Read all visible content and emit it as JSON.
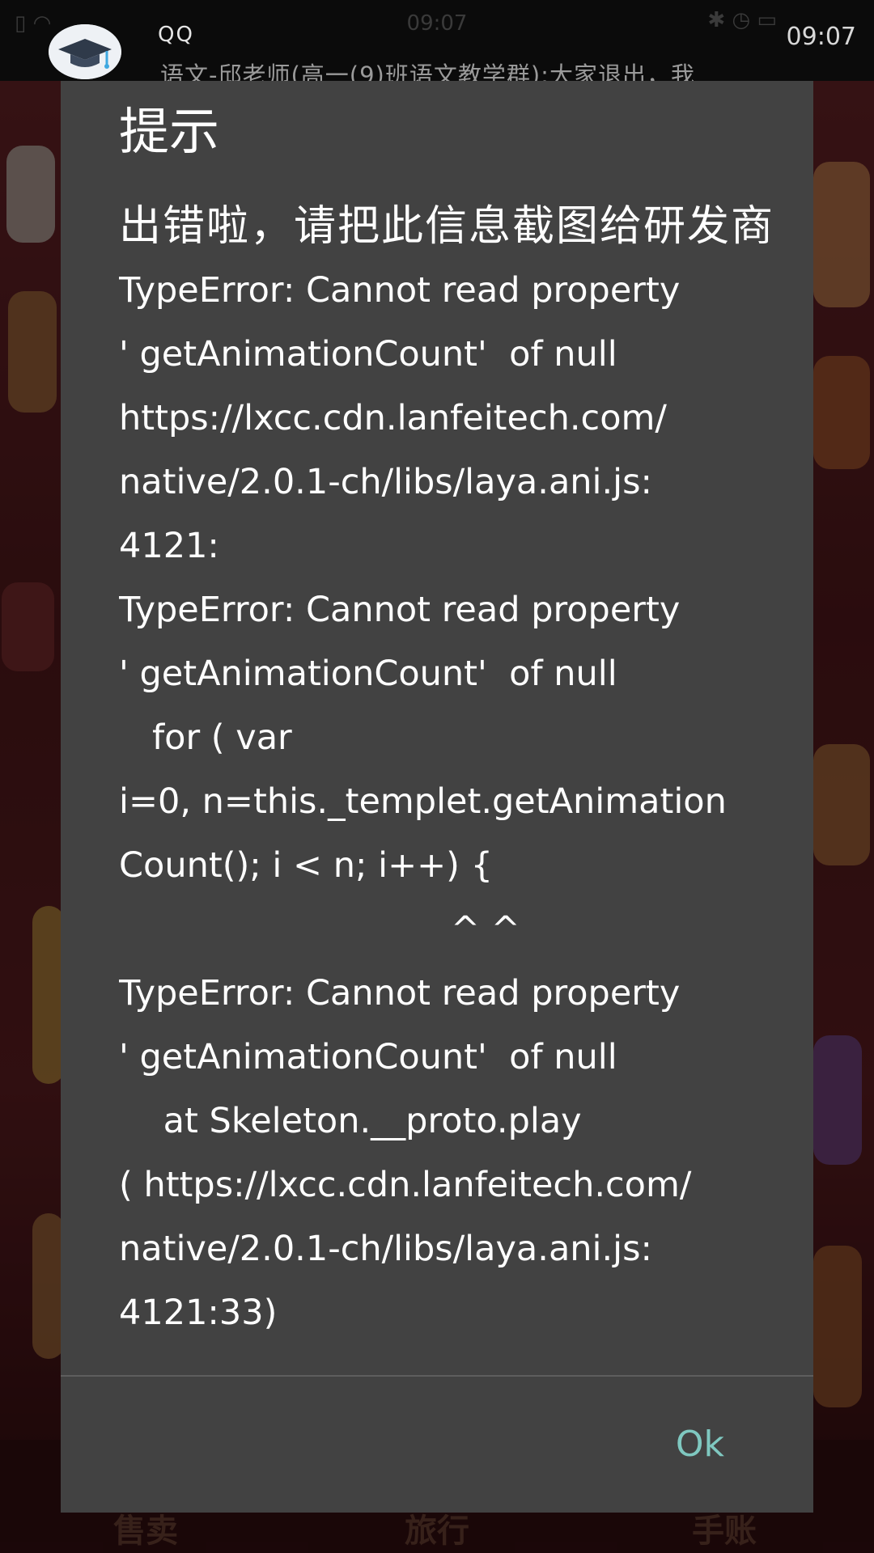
{
  "status_bar": {
    "time_center": "09:07",
    "time_right": "09:07",
    "left_icons": "▯ ◠",
    "right_icons": "✱ ◷ ▭"
  },
  "notification": {
    "app_name": "QQ",
    "avatar_icon": "graduation-cap-icon",
    "text": "语文-邱老师(高一(9)班语文教学群):大家退出，我"
  },
  "game_background": {
    "bottom_labels": [
      "售卖",
      "旅行",
      "手账"
    ]
  },
  "dialog": {
    "title": "提示",
    "message_cn": "出错啦，请把此信息截图给研发商",
    "error_lines": [
      "TypeError: Cannot read property",
      "' getAnimationCount'  of null",
      "https://lxcc.cdn.lanfeitech.com/",
      "native/2.0.1-ch/libs/laya.ani.js:",
      "4121:",
      "TypeError: Cannot read property",
      "' getAnimationCount'  of null",
      "   for ( var",
      "i=0, n=this._templet.getAnimation",
      "Count(); i < n; i++) {",
      "                              ^ ^",
      "TypeError: Cannot read property",
      "' getAnimationCount'  of null",
      "    at Skeleton.__proto.play",
      "( https://lxcc.cdn.lanfeitech.com/",
      "native/2.0.1-ch/libs/laya.ani.js:",
      "4121:33)"
    ],
    "ok_label": "Ok"
  }
}
